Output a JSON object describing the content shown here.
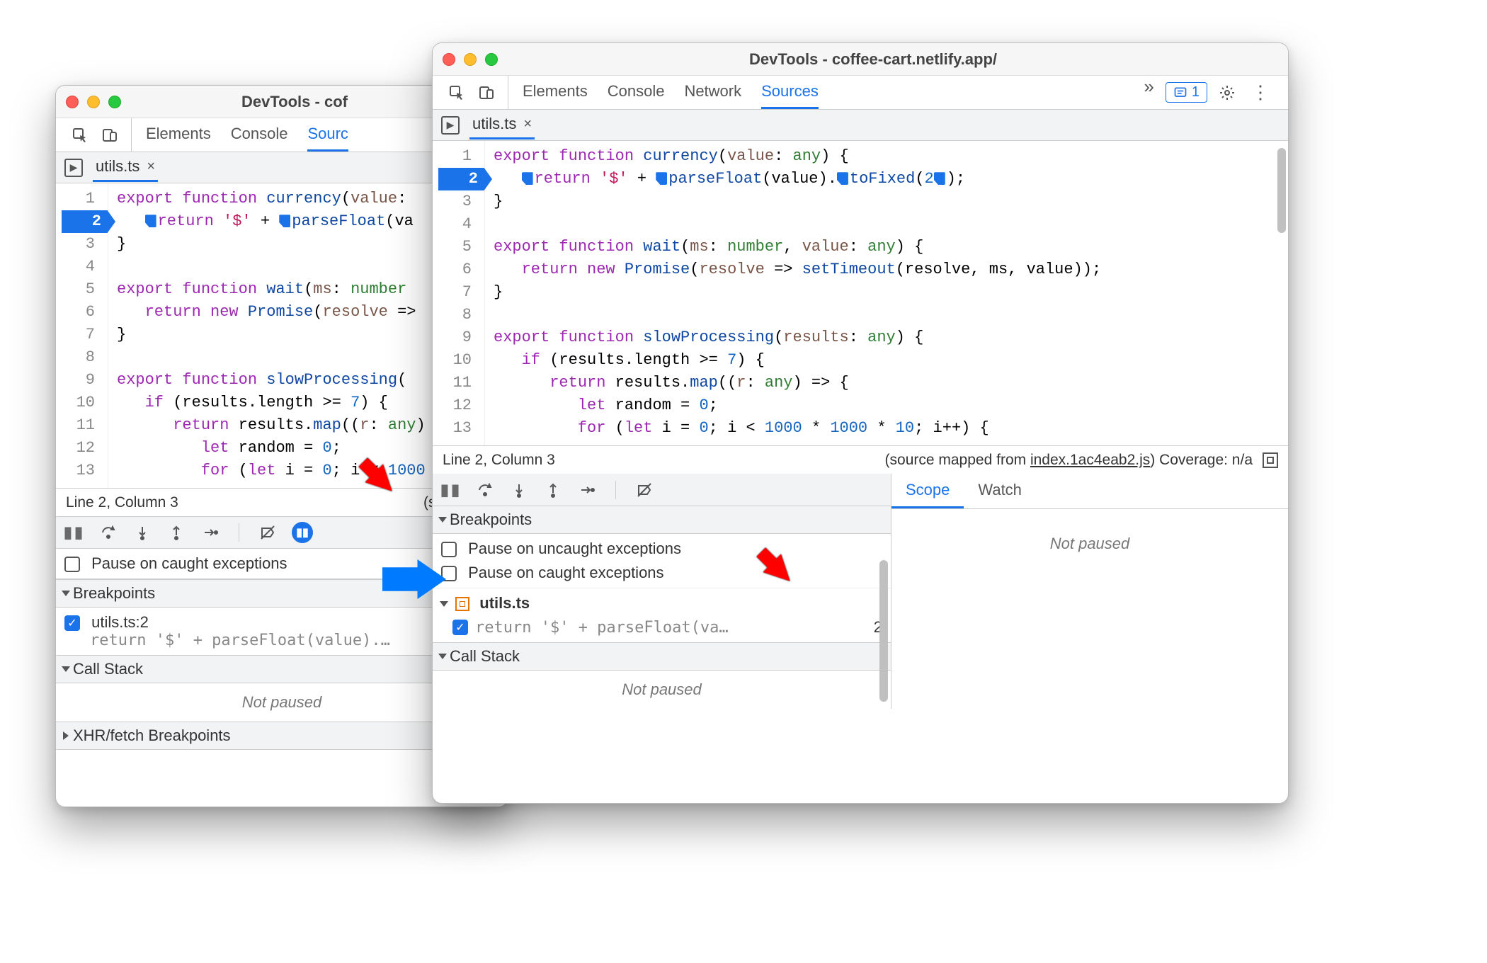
{
  "left": {
    "title": "DevTools - cof",
    "tabs": [
      "Elements",
      "Console",
      "Sourc"
    ],
    "active_tab": 2,
    "file": "utils.ts",
    "cursor": "Line 2, Column 3",
    "status_right": "(source ma",
    "pause_caught": "Pause on caught exceptions",
    "bp_section": "Breakpoints",
    "bp_item": "utils.ts:2",
    "bp_code": "return '$' + parseFloat(value).…",
    "callstack": "Call Stack",
    "not_paused": "Not paused",
    "xhr": "XHR/fetch Breakpoints",
    "gutter": [
      "1",
      "2",
      "3",
      "4",
      "5",
      "6",
      "7",
      "8",
      "9",
      "10",
      "11",
      "12",
      "13"
    ],
    "code": [
      [
        [
          "kw",
          "export"
        ],
        [
          "",
          " "
        ],
        [
          "kw",
          "function"
        ],
        [
          "",
          " "
        ],
        [
          "fn",
          "currency"
        ],
        [
          "",
          "("
        ],
        [
          "prm",
          "value"
        ],
        [
          "",
          ":"
        ]
      ],
      [
        [
          "",
          "   "
        ],
        [
          "colmark",
          ""
        ],
        [
          "kw",
          "return"
        ],
        [
          "",
          " "
        ],
        [
          "str",
          "'$'"
        ],
        [
          "",
          " + "
        ],
        [
          "colmark",
          ""
        ],
        [
          "fn",
          "parseFloat"
        ],
        [
          "",
          "(va"
        ]
      ],
      [
        [
          "",
          "}"
        ]
      ],
      [
        [
          "",
          ""
        ]
      ],
      [
        [
          "kw",
          "export"
        ],
        [
          "",
          " "
        ],
        [
          "kw",
          "function"
        ],
        [
          "",
          " "
        ],
        [
          "fn",
          "wait"
        ],
        [
          "",
          "("
        ],
        [
          "prm",
          "ms"
        ],
        [
          "",
          ": "
        ],
        [
          "typ",
          "number"
        ]
      ],
      [
        [
          "",
          "   "
        ],
        [
          "kw",
          "return"
        ],
        [
          "",
          " "
        ],
        [
          "kw",
          "new"
        ],
        [
          "",
          " "
        ],
        [
          "fn",
          "Promise"
        ],
        [
          "",
          "("
        ],
        [
          "prm",
          "resolve"
        ],
        [
          "",
          " =>"
        ]
      ],
      [
        [
          "",
          "}"
        ]
      ],
      [
        [
          "",
          ""
        ]
      ],
      [
        [
          "kw",
          "export"
        ],
        [
          "",
          " "
        ],
        [
          "kw",
          "function"
        ],
        [
          "",
          " "
        ],
        [
          "fn",
          "slowProcessing"
        ],
        [
          "",
          "("
        ]
      ],
      [
        [
          "",
          "   "
        ],
        [
          "kw",
          "if"
        ],
        [
          "",
          " (results.length >= "
        ],
        [
          "num",
          "7"
        ],
        [
          "",
          ") {"
        ]
      ],
      [
        [
          "",
          "      "
        ],
        [
          "kw",
          "return"
        ],
        [
          "",
          " results."
        ],
        [
          "fn",
          "map"
        ],
        [
          "",
          "(("
        ],
        [
          "prm",
          "r"
        ],
        [
          "",
          ": "
        ],
        [
          "typ",
          "any"
        ],
        [
          "",
          ")"
        ]
      ],
      [
        [
          "",
          "         "
        ],
        [
          "kw",
          "let"
        ],
        [
          "",
          " random = "
        ],
        [
          "num",
          "0"
        ],
        [
          "",
          ";"
        ]
      ],
      [
        [
          "",
          "         "
        ],
        [
          "kw",
          "for"
        ],
        [
          "",
          " ("
        ],
        [
          "kw",
          "let"
        ],
        [
          "",
          " i = "
        ],
        [
          "num",
          "0"
        ],
        [
          "",
          "; i < "
        ],
        [
          "num",
          "1000"
        ]
      ]
    ]
  },
  "right": {
    "title": "DevTools - coffee-cart.netlify.app/",
    "tabs": [
      "Elements",
      "Console",
      "Network",
      "Sources"
    ],
    "active_tab": 3,
    "issues_count": "1",
    "file": "utils.ts",
    "cursor": "Line 2, Column 3",
    "status_right_prefix": "(source mapped from ",
    "status_link": "index.1ac4eab2.js",
    "status_right_suffix": ") Coverage: n/a",
    "bp_section": "Breakpoints",
    "pause_uncaught": "Pause on uncaught exceptions",
    "pause_caught": "Pause on caught exceptions",
    "bp_file": "utils.ts",
    "bp_code": "return '$' + parseFloat(va…",
    "bp_line": "2",
    "callstack": "Call Stack",
    "not_paused": "Not paused",
    "scope": "Scope",
    "watch": "Watch",
    "scope_np": "Not paused",
    "gutter": [
      "1",
      "2",
      "3",
      "4",
      "5",
      "6",
      "7",
      "8",
      "9",
      "10",
      "11",
      "12",
      "13"
    ],
    "code": [
      [
        [
          "kw",
          "export"
        ],
        [
          "",
          " "
        ],
        [
          "kw",
          "function"
        ],
        [
          "",
          " "
        ],
        [
          "fn",
          "currency"
        ],
        [
          "",
          "("
        ],
        [
          "prm",
          "value"
        ],
        [
          "",
          ": "
        ],
        [
          "typ",
          "any"
        ],
        [
          "",
          ") {"
        ]
      ],
      [
        [
          "",
          "   "
        ],
        [
          "colmark",
          ""
        ],
        [
          "kw",
          "return"
        ],
        [
          "",
          " "
        ],
        [
          "str",
          "'$'"
        ],
        [
          "",
          " + "
        ],
        [
          "colmark",
          ""
        ],
        [
          "fn",
          "parseFloat"
        ],
        [
          "",
          "(value)."
        ],
        [
          "colmark",
          ""
        ],
        [
          "fn",
          "toFixed"
        ],
        [
          "",
          "("
        ],
        [
          "num",
          "2"
        ],
        [
          "colmark",
          ""
        ],
        [
          "",
          ");"
        ]
      ],
      [
        [
          "",
          "}"
        ]
      ],
      [
        [
          "",
          ""
        ]
      ],
      [
        [
          "kw",
          "export"
        ],
        [
          "",
          " "
        ],
        [
          "kw",
          "function"
        ],
        [
          "",
          " "
        ],
        [
          "fn",
          "wait"
        ],
        [
          "",
          "("
        ],
        [
          "prm",
          "ms"
        ],
        [
          "",
          ": "
        ],
        [
          "typ",
          "number"
        ],
        [
          "",
          ", "
        ],
        [
          "prm",
          "value"
        ],
        [
          "",
          ": "
        ],
        [
          "typ",
          "any"
        ],
        [
          "",
          ") {"
        ]
      ],
      [
        [
          "",
          "   "
        ],
        [
          "kw",
          "return"
        ],
        [
          "",
          " "
        ],
        [
          "kw",
          "new"
        ],
        [
          "",
          " "
        ],
        [
          "fn",
          "Promise"
        ],
        [
          "",
          "("
        ],
        [
          "prm",
          "resolve"
        ],
        [
          "",
          " => "
        ],
        [
          "fn",
          "setTimeout"
        ],
        [
          "",
          "(resolve, ms, value));"
        ]
      ],
      [
        [
          "",
          "}"
        ]
      ],
      [
        [
          "",
          ""
        ]
      ],
      [
        [
          "kw",
          "export"
        ],
        [
          "",
          " "
        ],
        [
          "kw",
          "function"
        ],
        [
          "",
          " "
        ],
        [
          "fn",
          "slowProcessing"
        ],
        [
          "",
          "("
        ],
        [
          "prm",
          "results"
        ],
        [
          "",
          ": "
        ],
        [
          "typ",
          "any"
        ],
        [
          "",
          ") {"
        ]
      ],
      [
        [
          "",
          "   "
        ],
        [
          "kw",
          "if"
        ],
        [
          "",
          " (results.length >= "
        ],
        [
          "num",
          "7"
        ],
        [
          "",
          ") {"
        ]
      ],
      [
        [
          "",
          "      "
        ],
        [
          "kw",
          "return"
        ],
        [
          "",
          " results."
        ],
        [
          "fn",
          "map"
        ],
        [
          "",
          "(("
        ],
        [
          "prm",
          "r"
        ],
        [
          "",
          ": "
        ],
        [
          "typ",
          "any"
        ],
        [
          "",
          ") => {"
        ]
      ],
      [
        [
          "",
          "         "
        ],
        [
          "kw",
          "let"
        ],
        [
          "",
          " random = "
        ],
        [
          "num",
          "0"
        ],
        [
          "",
          ";"
        ]
      ],
      [
        [
          "",
          "         "
        ],
        [
          "kw",
          "for"
        ],
        [
          "",
          " ("
        ],
        [
          "kw",
          "let"
        ],
        [
          "",
          " i = "
        ],
        [
          "num",
          "0"
        ],
        [
          "",
          "; i < "
        ],
        [
          "num",
          "1000"
        ],
        [
          "",
          " * "
        ],
        [
          "num",
          "1000"
        ],
        [
          "",
          " * "
        ],
        [
          "num",
          "10"
        ],
        [
          "",
          "; i++) {"
        ]
      ]
    ]
  }
}
